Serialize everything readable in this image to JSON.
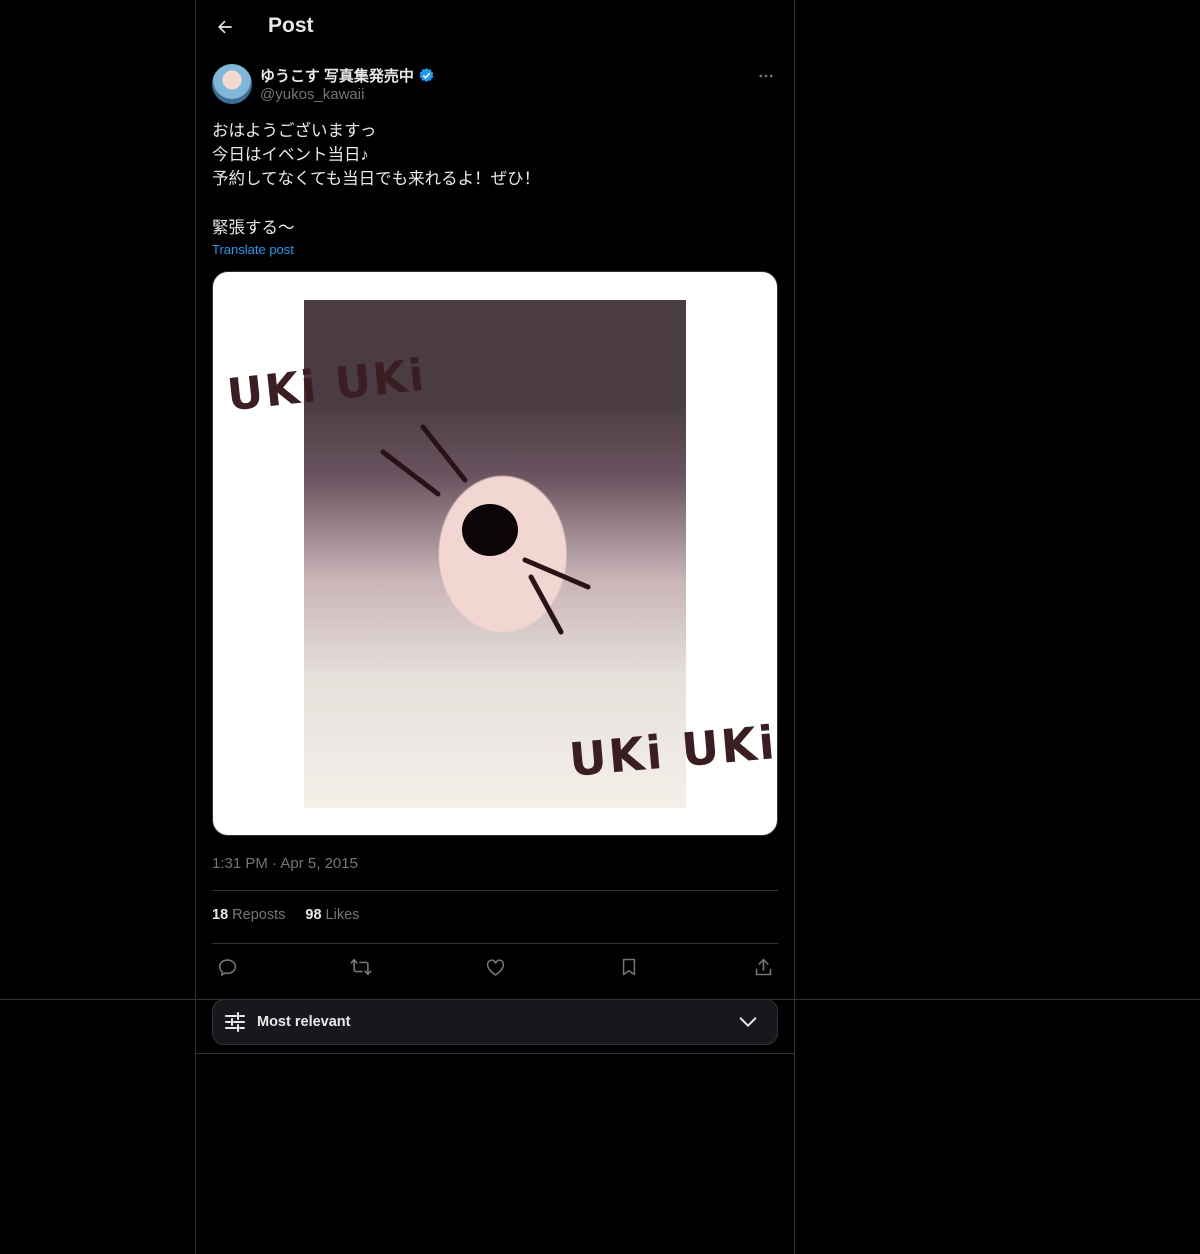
{
  "header": {
    "title": "Post"
  },
  "author": {
    "display_name": "ゆうこす 写真集発売中",
    "handle": "@yukos_kawaii",
    "verified": true
  },
  "post": {
    "text": "おはようございますっ\n今日はイベント当日♪\n予約してなくても当日でも来れるよ！ぜひ！\n\n緊張する〜",
    "translate_label": "Translate post",
    "image_text_top": "UKi UKi",
    "image_text_bottom": "UKi UKi",
    "time": "1:31 PM",
    "date": "Apr 5, 2015"
  },
  "stats": {
    "reposts_count": "18",
    "reposts_label": "Reposts",
    "likes_count": "98",
    "likes_label": "Likes"
  },
  "actions": [
    "reply-icon",
    "repost-icon",
    "like-icon",
    "bookmark-icon",
    "share-icon"
  ],
  "sort": {
    "label": "Most relevant"
  },
  "colors": {
    "accent": "#1d9bf0",
    "border": "#2f3336",
    "muted": "#71767b"
  }
}
